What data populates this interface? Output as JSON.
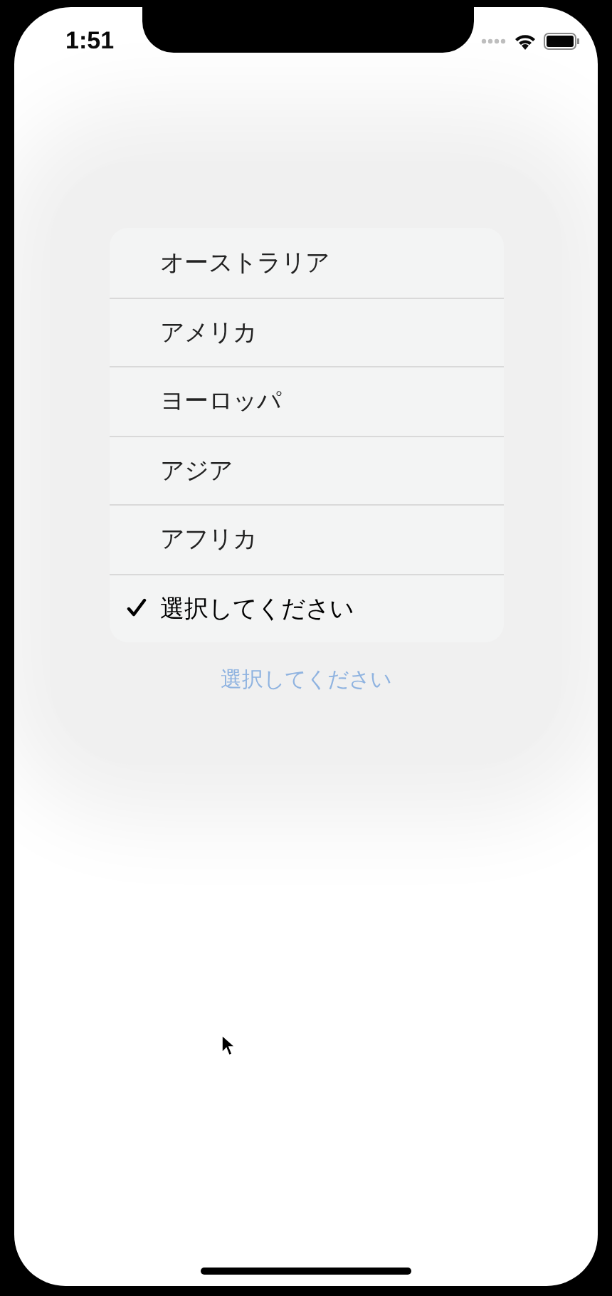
{
  "status_bar": {
    "time": "1:51"
  },
  "menu": {
    "items": [
      {
        "label": "オーストラリア",
        "selected": false
      },
      {
        "label": "アメリカ",
        "selected": false
      },
      {
        "label": "ヨーロッパ",
        "selected": false
      },
      {
        "label": "アジア",
        "selected": false
      },
      {
        "label": "アフリカ",
        "selected": false
      },
      {
        "label": "選択してください",
        "selected": true
      }
    ]
  },
  "picker": {
    "value": "選択してください"
  }
}
